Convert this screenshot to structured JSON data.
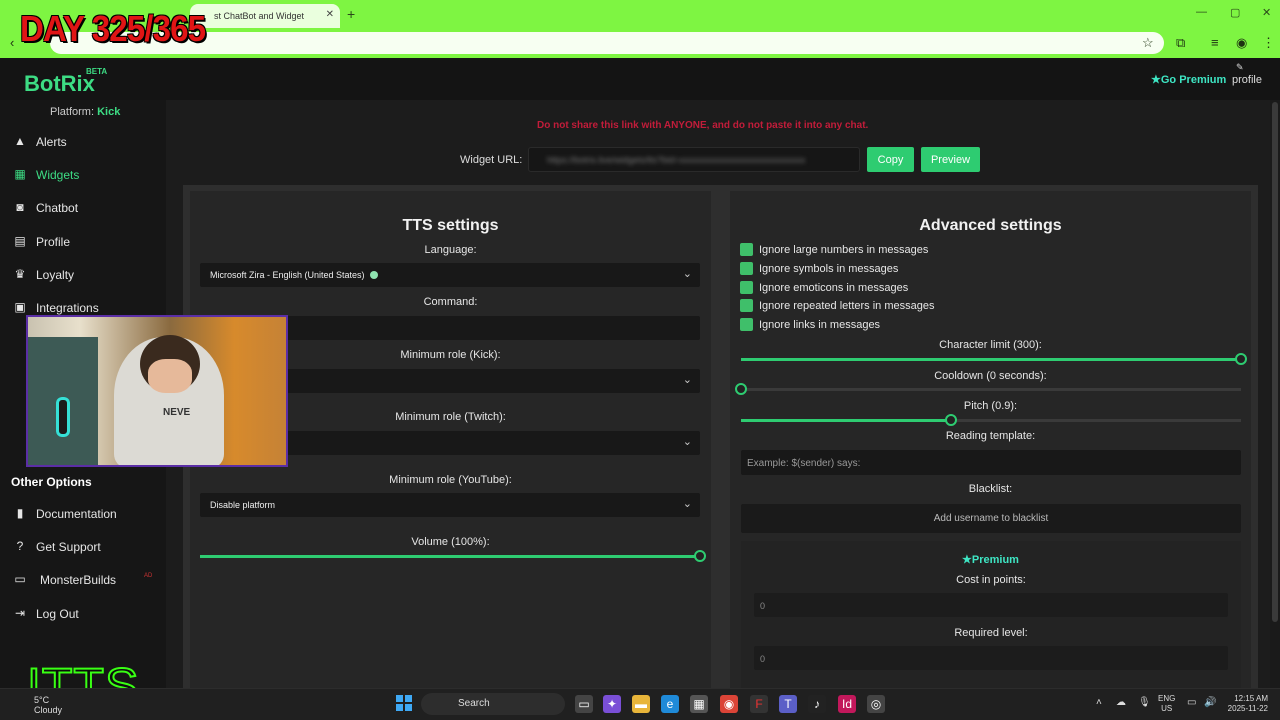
{
  "overlay": {
    "day_counter": "DAY 325/365",
    "itts": "ITTS"
  },
  "browser": {
    "tab_title": "st ChatBot and Widget",
    "url_placeholder": "",
    "tab_close": "✕",
    "new_tab": "+"
  },
  "header": {
    "logo": "BotRix",
    "beta": "BETA",
    "go_premium": "Go Premium",
    "profile": "profile"
  },
  "sidebar": {
    "platform_label": "Platform:",
    "platform_value": "Kick",
    "items": [
      {
        "label": "Alerts"
      },
      {
        "label": "Widgets"
      },
      {
        "label": "Chatbot"
      },
      {
        "label": "Profile"
      },
      {
        "label": "Loyalty"
      },
      {
        "label": "Integrations"
      }
    ],
    "other_options": "Other Options",
    "other_items": [
      {
        "label": "Documentation"
      },
      {
        "label": "Get Support"
      },
      {
        "label": "MonsterBuilds"
      },
      {
        "label": "Log Out"
      }
    ]
  },
  "main": {
    "warning": "Do not share this link with ANYONE, and do not paste it into any chat.",
    "widget_url_label": "Widget URL:",
    "widget_url_value": "https://botrix.live/widgets/tts?bid=xxxxxxxxxxxxxxxxxxxxxxxxxxxx",
    "copy": "Copy",
    "preview": "Preview"
  },
  "tts": {
    "title": "TTS settings",
    "language_label": "Language:",
    "language_value": "Microsoft Zira - English (United States)",
    "command_label": "Command:",
    "command_value": "",
    "min_role_kick_label": "Minimum role (Kick):",
    "min_role_kick_value": "",
    "min_role_twitch_label": "Minimum role (Twitch):",
    "min_role_twitch_value": "",
    "min_role_youtube_label": "Minimum role (YouTube):",
    "min_role_youtube_value": "Disable platform",
    "volume_label": "Volume (100%):",
    "volume_fraction": 1.0
  },
  "advanced": {
    "title": "Advanced settings",
    "checks": [
      {
        "label": "Ignore large numbers in messages",
        "checked": true
      },
      {
        "label": "Ignore symbols in messages",
        "checked": true
      },
      {
        "label": "Ignore emoticons in messages",
        "checked": true
      },
      {
        "label": "Ignore repeated letters in messages",
        "checked": true
      },
      {
        "label": "Ignore links in messages",
        "checked": true
      }
    ],
    "char_limit_label": "Character limit (300):",
    "char_limit_fraction": 1.0,
    "cooldown_label": "Cooldown (0 seconds):",
    "cooldown_fraction": 0.0,
    "pitch_label": "Pitch (0.9):",
    "pitch_fraction": 0.42,
    "reading_template_label": "Reading template:",
    "reading_template_placeholder": "Example: $(sender) says:",
    "blacklist_label": "Blacklist:",
    "blacklist_placeholder": "Add username to blacklist",
    "premium_title": "Premium",
    "cost_label": "Cost in points:",
    "cost_value": "0",
    "required_level_label": "Required level:",
    "required_level_value": "0"
  },
  "webcam": {
    "shirt_text": "NEVE"
  },
  "taskbar": {
    "weather_temp": "5°C",
    "weather_desc": "Cloudy",
    "search": "Search",
    "lang_top": "ENG",
    "lang_bottom": "US",
    "time": "12:15 AM",
    "date": "2025-11-22"
  },
  "colors": {
    "accent": "#3ddc84",
    "premium": "#3ee6c4",
    "warning": "#c21c3a",
    "browser_green": "#7ef542"
  }
}
